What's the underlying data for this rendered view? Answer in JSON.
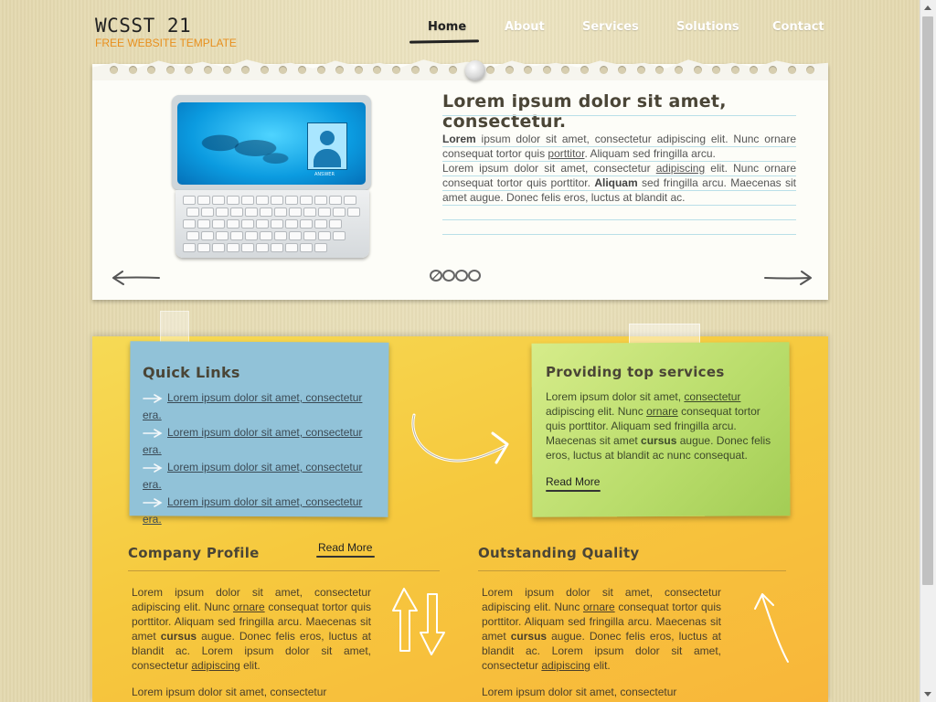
{
  "header": {
    "logo_title": "WCSST 21",
    "logo_subtitle": "FREE WEBSITE TEMPLATE",
    "nav": [
      "Home",
      "About",
      "Services",
      "Solutions",
      "Contact"
    ],
    "active_nav": "Home"
  },
  "slider": {
    "title": "Lorem ipsum dolor sit amet, consectetur.",
    "para1_b1": "Lorem",
    "para1_t1": " ipsum dolor sit amet, consectetur adipiscing elit. Nunc ornare consequat tortor quis ",
    "para1_u1": "porttitor",
    "para1_t2": ". Aliquam sed fringilla arcu.",
    "para2_t1": "Lorem ipsum dolor sit amet, consectetur ",
    "para2_u1": "adipiscing",
    "para2_t2": " elit. Nunc ornare consequat tortor quis porttitor. ",
    "para2_b1": "Aliquam",
    "para2_t3": " sed fringilla arcu. Maecenas sit amet augue. Donec felis eros, luctus at blandit ac.",
    "pager_count": 4,
    "active_page": 1,
    "device_screen_label": "ANSWER"
  },
  "quick_links": {
    "title": "Quick Links",
    "items": [
      {
        "label": "Lorem ipsum dolor sit amet, consectetur era."
      },
      {
        "label": "Lorem ipsum dolor sit amet, consectetur era."
      },
      {
        "label": "Lorem ipsum dolor sit amet, consectetur era."
      },
      {
        "label": "Lorem ipsum dolor sit amet, consectetur era."
      }
    ]
  },
  "services": {
    "title": "Providing top services",
    "t1": "Lorem ipsum dolor sit amet, ",
    "u1": "consectetur",
    "t2": " adipiscing elit. Nunc ",
    "u2": "ornare",
    "t3": " consequat tortor quis porttitor. Aliquam sed fringilla arcu. Maecenas sit amet ",
    "b1": "cursus",
    "t4": " augue. Donec felis eros, luctus at blandit ac nunc consequat.",
    "read_more": "Read More"
  },
  "company_profile": {
    "title": "Company Profile",
    "read_more": "Read More",
    "t1": "Lorem ipsum dolor sit amet, consectetur adipiscing elit. Nunc ",
    "u1": "ornare",
    "t2": " consequat tortor quis porttitor. Aliquam sed fringilla arcu. Maecenas sit amet ",
    "b1": "cursus",
    "t3": " augue. Donec felis eros, luctus at blandit ac. Lorem ipsum dolor sit amet, consectetur ",
    "u2": "adipiscing",
    "t4": " elit.",
    "p2": "Lorem ipsum dolor sit amet, consectetur"
  },
  "outstanding_quality": {
    "title": "Outstanding Quality",
    "t1": "Lorem ipsum dolor sit amet, consectetur adipiscing elit. Nunc ",
    "u1": "ornare",
    "t2": " consequat tortor quis porttitor. Aliquam sed fringilla arcu. Maecenas sit amet ",
    "b1": "cursus",
    "t3": " augue. Donec felis eros, luctus at blandit ac. Lorem ipsum dolor sit amet, consectetur ",
    "u2": "adipiscing",
    "t4": " elit.",
    "p2": "Lorem ipsum dolor sit amet, consectetur"
  },
  "colors": {
    "background": "#e6dcb5",
    "logo_subtitle": "#e8901e",
    "note_blue": "#91c2d8",
    "note_green": "#b8dc6a",
    "yellow_panel": "#f6c93e"
  },
  "icons": [
    "arrow-left-icon",
    "arrow-right-icon",
    "pin-icon",
    "curved-arrow-icon",
    "swap-arrows-icon",
    "up-arrow-icon"
  ]
}
